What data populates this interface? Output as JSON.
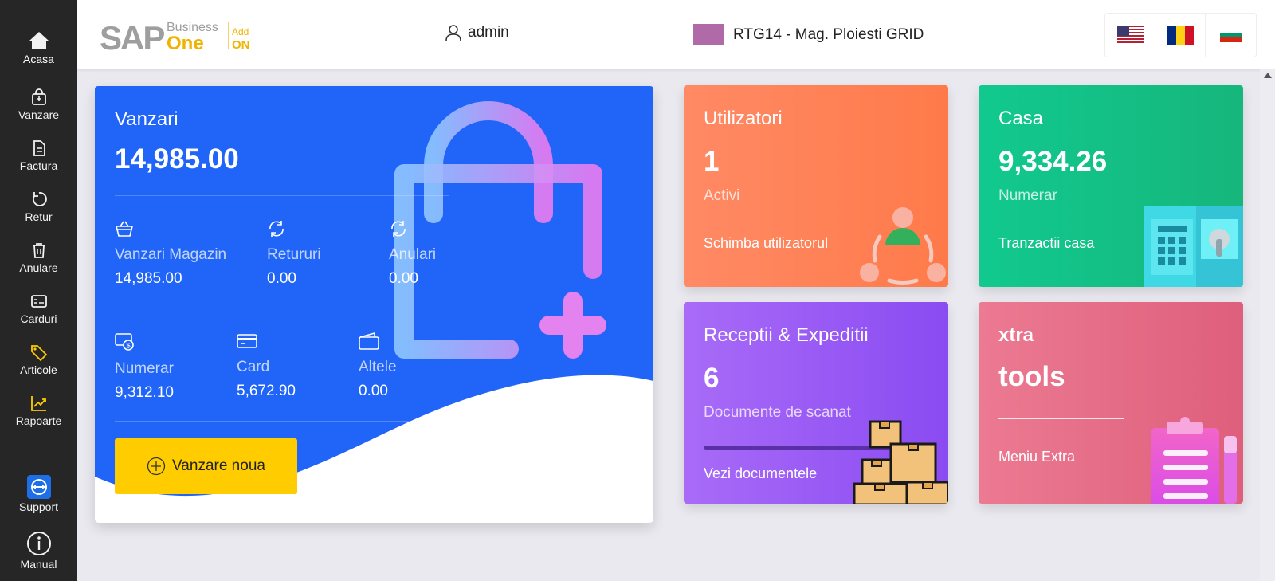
{
  "sidebar": {
    "items": [
      {
        "label": "Acasa",
        "icon": "home-icon"
      },
      {
        "label": "Vanzare",
        "icon": "shopping-bag-icon"
      },
      {
        "label": "Factura",
        "icon": "document-icon"
      },
      {
        "label": "Retur",
        "icon": "return-icon"
      },
      {
        "label": "Anulare",
        "icon": "trash-icon"
      },
      {
        "label": "Carduri",
        "icon": "card-icon"
      },
      {
        "label": "Articole",
        "icon": "tag-icon"
      },
      {
        "label": "Rapoarte",
        "icon": "chart-icon"
      }
    ],
    "support_label": "Support",
    "manual_label": "Manual",
    "accent": "#ffcc00"
  },
  "header": {
    "logo": {
      "main": "SAP",
      "business": "Business",
      "one": "One",
      "add": "Add",
      "on": "ON"
    },
    "user": "admin",
    "store": "RTG14 - Mag. Ploiesti GRID",
    "store_color": "#b06aa8",
    "flags": [
      "US",
      "RO",
      "BG"
    ]
  },
  "sales": {
    "title": "Vanzari",
    "total": "14,985.00",
    "row1": [
      {
        "label": "Vanzari Magazin",
        "value": "14,985.00",
        "icon": "basket-icon"
      },
      {
        "label": "Retururi",
        "value": "0.00",
        "icon": "refresh-icon"
      },
      {
        "label": "Anulari",
        "value": "0.00",
        "icon": "refresh-icon"
      }
    ],
    "row2": [
      {
        "label": "Numerar",
        "value": "9,312.10",
        "icon": "cash-icon"
      },
      {
        "label": "Card",
        "value": "5,672.90",
        "icon": "credit-card-icon"
      },
      {
        "label": "Altele",
        "value": "0.00",
        "icon": "wallet-icon"
      }
    ],
    "button": "Vanzare noua",
    "color": "#2065f7"
  },
  "tiles": {
    "users": {
      "title": "Utilizatori",
      "value": "1",
      "sub": "Activi",
      "link": "Schimba utilizatorul"
    },
    "cash": {
      "title": "Casa",
      "value": "9,334.26",
      "sub": "Numerar",
      "link": "Tranzactii casa"
    },
    "receipts": {
      "title": "Receptii & Expeditii",
      "value": "6",
      "sub": "Documente de scanat",
      "link": "Vezi documentele"
    },
    "tools": {
      "title": "xtra",
      "value": "tools",
      "link": "Meniu Extra"
    }
  }
}
